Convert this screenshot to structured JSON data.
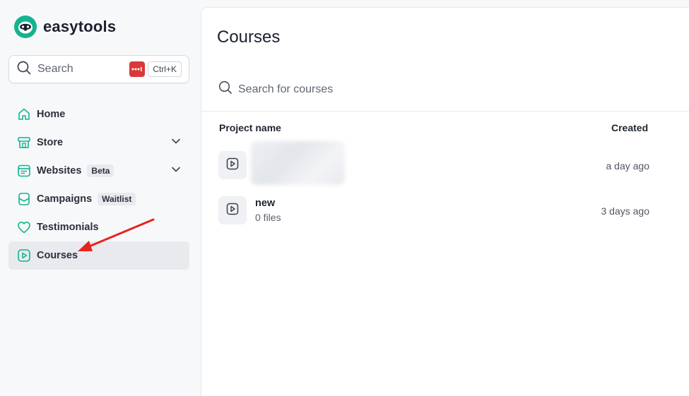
{
  "brand": {
    "name": "easytools"
  },
  "sidebar": {
    "search": {
      "label": "Search",
      "shortcut": "Ctrl+K"
    },
    "items": [
      {
        "label": "Home",
        "icon": "home-icon",
        "tag": "",
        "chevron": false,
        "active": false
      },
      {
        "label": "Store",
        "icon": "store-icon",
        "tag": "",
        "chevron": true,
        "active": false
      },
      {
        "label": "Websites",
        "icon": "websites-icon",
        "tag": "Beta",
        "chevron": true,
        "active": false
      },
      {
        "label": "Campaigns",
        "icon": "campaigns-icon",
        "tag": "Waitlist",
        "chevron": false,
        "active": false
      },
      {
        "label": "Testimonials",
        "icon": "heart-icon",
        "tag": "",
        "chevron": false,
        "active": false
      },
      {
        "label": "Courses",
        "icon": "play-icon",
        "tag": "",
        "chevron": false,
        "active": true
      }
    ]
  },
  "main": {
    "title": "Courses",
    "search_placeholder": "Search for courses",
    "table": {
      "columns": [
        "Project name",
        "Created"
      ],
      "rows": [
        {
          "title": "",
          "subtitle": "",
          "created": "a day ago",
          "blurred": true
        },
        {
          "title": "new",
          "subtitle": "0 files",
          "created": "3 days ago",
          "blurred": false
        }
      ]
    }
  },
  "colors": {
    "accent": "#13b38e",
    "annotation_arrow": "#e8231e",
    "shortcut_badge": "#d9383a"
  }
}
